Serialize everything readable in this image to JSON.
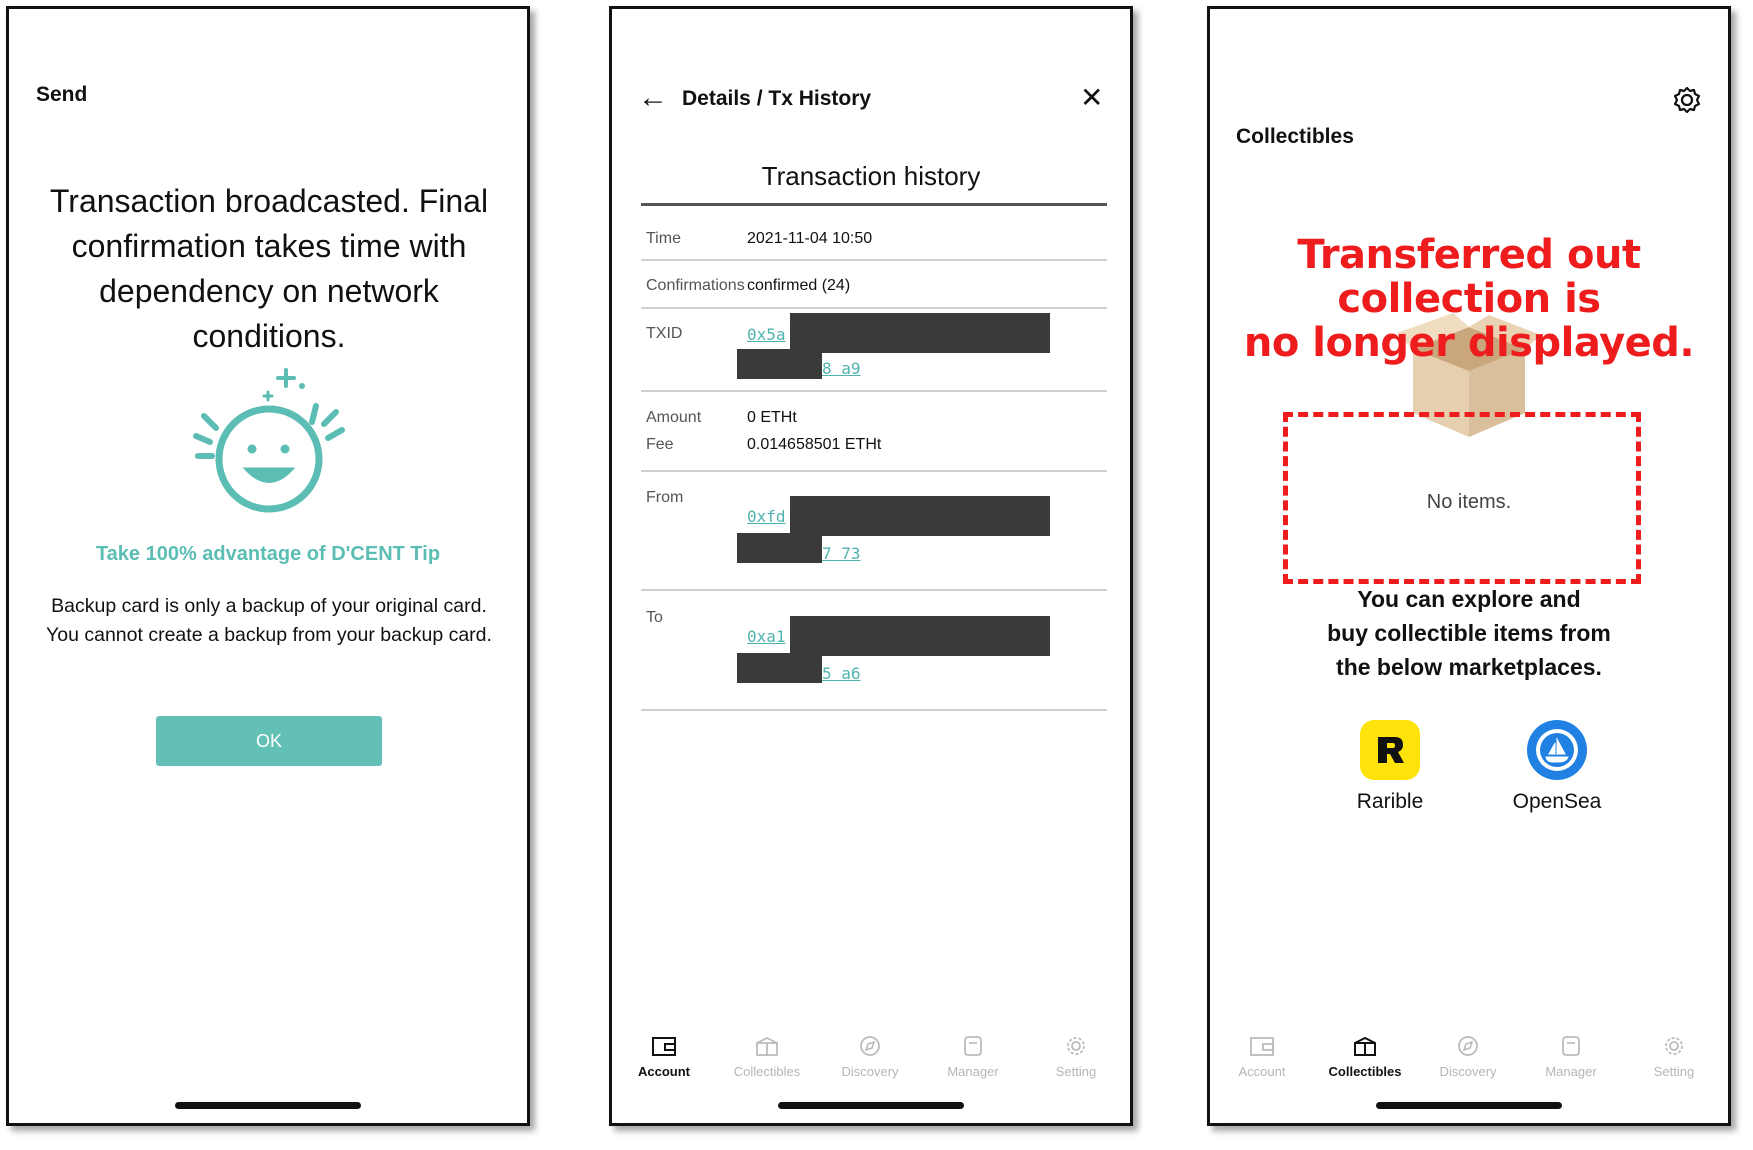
{
  "phone1": {
    "title": "Send",
    "message": "Transaction broadcasted. Final confirmation takes time with dependency on network conditions.",
    "tip": "Take 100% advantage of D'CENT Tip",
    "body_line1": "Backup card is only a backup of your original card.",
    "body_line2": "You cannot create a backup from your backup card.",
    "ok_label": "OK",
    "accent": "#62c0b6"
  },
  "phone2": {
    "title": "Details / Tx History",
    "heading": "Transaction history",
    "time_label": "Time",
    "time_value": "2021-11-04 10:50",
    "confirmations_label": "Confirmations",
    "confirmations_value": "confirmed (24)",
    "txid_label": "TXID",
    "txid_start": "0x5a",
    "txid_end": "8 a9",
    "amount_label": "Amount",
    "amount_value": "0 ETHt",
    "fee_label": "Fee",
    "fee_value": "0.014658501 ETHt",
    "from_label": "From",
    "from_start": "0xfd",
    "from_end": "7 73",
    "to_label": "To",
    "to_start": "0xa1",
    "to_end": "5 a6",
    "tabs": [
      "Account",
      "Collectibles",
      "Discovery",
      "Manager",
      "Setting"
    ],
    "active_tab": "Account"
  },
  "phone3": {
    "title": "Collectibles",
    "annotation_line1": "Transferred out collection is",
    "annotation_line2": "no longer displayed.",
    "no_items": "No items.",
    "explore_line1": "You can explore and",
    "explore_line2": "buy collectible items from",
    "explore_line3": "the below marketplaces.",
    "market1": "Rarible",
    "market2": "OpenSea",
    "tabs": [
      "Account",
      "Collectibles",
      "Discovery",
      "Manager",
      "Setting"
    ],
    "active_tab": "Collectibles",
    "annotation_color": "#ee1c1c"
  }
}
